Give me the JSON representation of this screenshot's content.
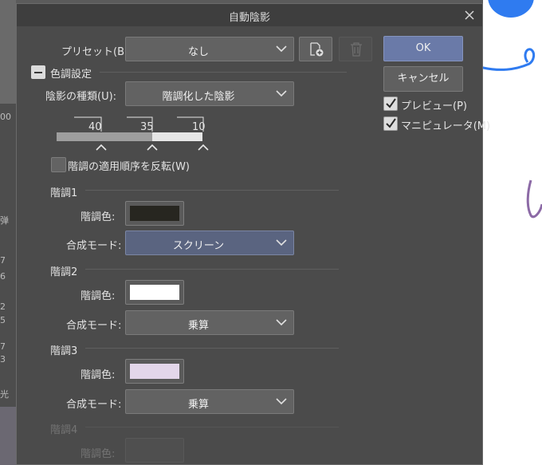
{
  "dialog": {
    "title": "自動陰影",
    "preset_label": "プリセット(B):",
    "preset_value": "なし",
    "ok_label": "OK",
    "cancel_label": "キャンセル",
    "preview_label": "プレビュー(P)",
    "preview_checked": true,
    "manipulator_label": "マニピュレータ(M)",
    "manipulator_checked": true,
    "tone_section_label": "色調設定",
    "shadow_type_label": "陰影の種類(U):",
    "shadow_type_value": "階調化した陰影",
    "gradient_stops": [
      "40",
      "35",
      "10"
    ],
    "reverse_label": "階調の適用順序を反転(W)",
    "reverse_checked": false,
    "color_label": "階調色:",
    "blend_label": "合成モード:",
    "tones": [
      {
        "heading": "階調1",
        "color": "#272620",
        "blend_mode": "スクリーン"
      },
      {
        "heading": "階調2",
        "color": "#ffffff",
        "blend_mode": "乗算"
      },
      {
        "heading": "階調3",
        "color": "#e3d6ea",
        "blend_mode": "乗算"
      },
      {
        "heading": "階調4",
        "color": "#4f4f4f"
      }
    ]
  },
  "background": {
    "left_chars": [
      "00",
      "弹",
      "7",
      "6",
      "2",
      "5",
      "7",
      "3",
      "光"
    ]
  }
}
